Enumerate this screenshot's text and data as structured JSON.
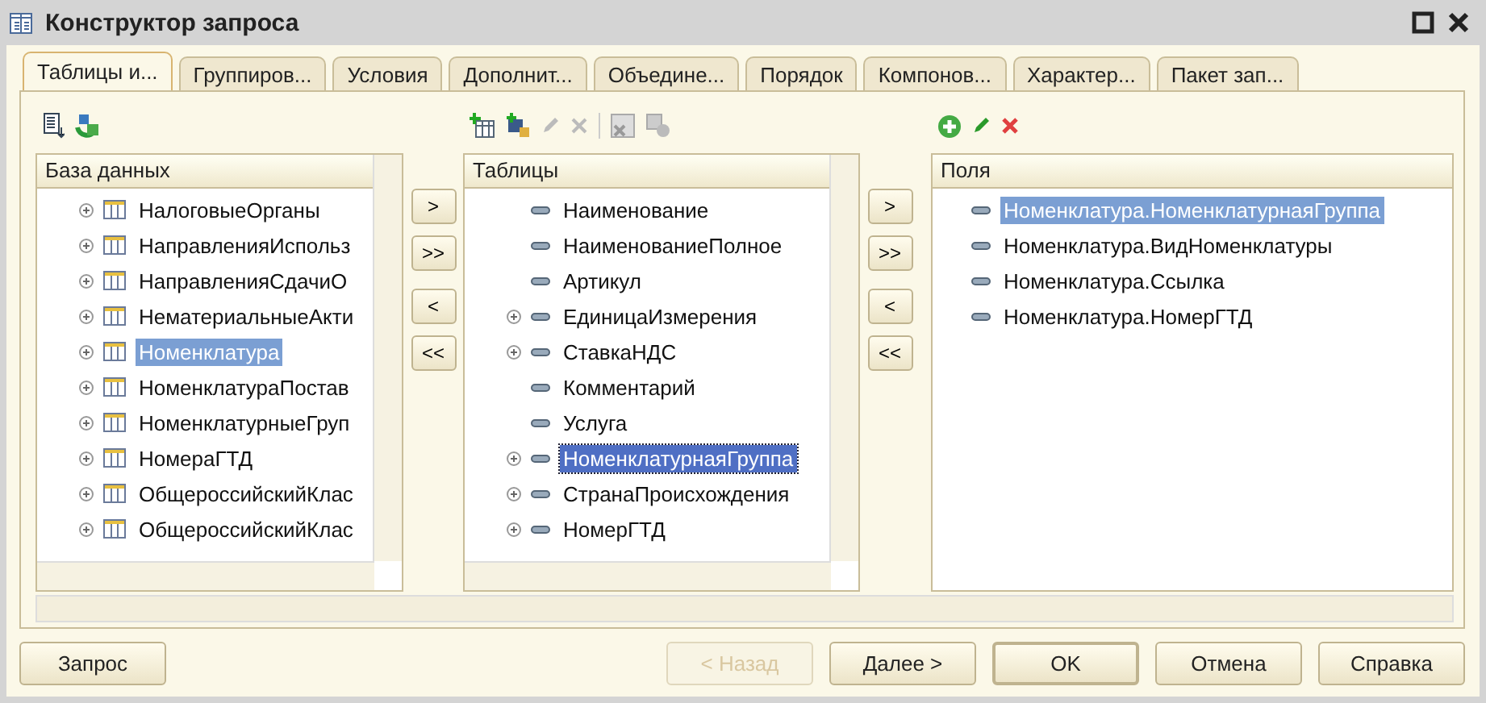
{
  "window": {
    "title": "Конструктор запроса"
  },
  "tabs": [
    {
      "label": "Таблицы и...",
      "selected": true
    },
    {
      "label": "Группиров...",
      "selected": false
    },
    {
      "label": "Условия",
      "selected": false
    },
    {
      "label": "Дополнит...",
      "selected": false
    },
    {
      "label": "Объедине...",
      "selected": false
    },
    {
      "label": "Порядок",
      "selected": false
    },
    {
      "label": "Компонов...",
      "selected": false
    },
    {
      "label": "Характер...",
      "selected": false
    },
    {
      "label": "Пакет зап...",
      "selected": false
    }
  ],
  "database": {
    "header": "База данных",
    "items": [
      {
        "label": "НалоговыеОрганы",
        "expandable": true,
        "selected": false
      },
      {
        "label": "НаправленияИспольз",
        "expandable": true,
        "selected": false
      },
      {
        "label": "НаправленияСдачиО",
        "expandable": true,
        "selected": false
      },
      {
        "label": "НематериальныеАкти",
        "expandable": true,
        "selected": false
      },
      {
        "label": "Номенклатура",
        "expandable": true,
        "selected": true
      },
      {
        "label": "НоменклатураПостав",
        "expandable": true,
        "selected": false
      },
      {
        "label": "НоменклатурныеГруп",
        "expandable": true,
        "selected": false
      },
      {
        "label": "НомераГТД",
        "expandable": true,
        "selected": false
      },
      {
        "label": "ОбщероссийскийКлас",
        "expandable": true,
        "selected": false
      },
      {
        "label": "ОбщероссийскийКлас",
        "expandable": true,
        "selected": false
      }
    ]
  },
  "move_buttons_1": [
    ">",
    ">>",
    "<",
    "<<"
  ],
  "tables": {
    "header": "Таблицы",
    "items": [
      {
        "label": "Наименование",
        "expandable": false,
        "selected": false
      },
      {
        "label": "НаименованиеПолное",
        "expandable": false,
        "selected": false
      },
      {
        "label": "Артикул",
        "expandable": false,
        "selected": false
      },
      {
        "label": "ЕдиницаИзмерения",
        "expandable": true,
        "selected": false
      },
      {
        "label": "СтавкаНДС",
        "expandable": true,
        "selected": false
      },
      {
        "label": "Комментарий",
        "expandable": false,
        "selected": false
      },
      {
        "label": "Услуга",
        "expandable": false,
        "selected": false
      },
      {
        "label": "НоменклатурнаяГруппа",
        "expandable": true,
        "selected": true
      },
      {
        "label": "СтранаПроисхождения",
        "expandable": true,
        "selected": false
      },
      {
        "label": "НомерГТД",
        "expandable": true,
        "selected": false
      }
    ]
  },
  "move_buttons_2": [
    ">",
    ">>",
    "<",
    "<<"
  ],
  "fields": {
    "header": "Поля",
    "items": [
      {
        "label": "Номенклатура.НоменклатурнаяГруппа",
        "selected": true
      },
      {
        "label": "Номенклатура.ВидНоменклатуры",
        "selected": false
      },
      {
        "label": "Номенклатура.Ссылка",
        "selected": false
      },
      {
        "label": "Номенклатура.НомерГТД",
        "selected": false
      }
    ]
  },
  "buttons": [
    {
      "label": "Запрос",
      "disabled": false
    },
    {
      "label": "< Назад",
      "disabled": true
    },
    {
      "label": "Далее >",
      "disabled": false
    },
    {
      "label": "OK",
      "disabled": false
    },
    {
      "label": "Отмена",
      "disabled": false
    },
    {
      "label": "Справка",
      "disabled": false
    }
  ]
}
